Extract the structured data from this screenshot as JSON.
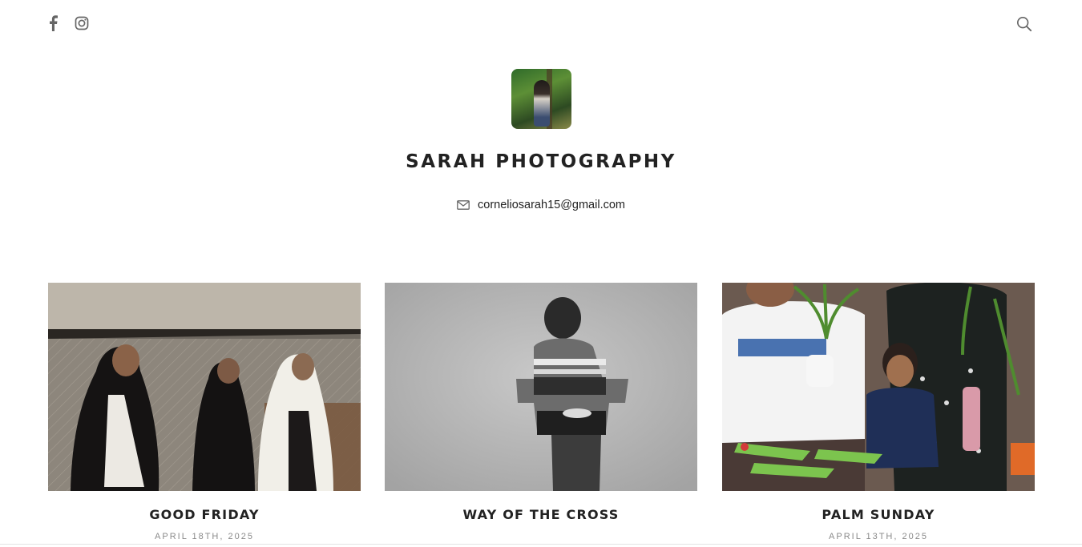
{
  "header": {
    "social": [
      {
        "name": "facebook",
        "icon": "facebook-icon"
      },
      {
        "name": "instagram",
        "icon": "instagram-icon"
      }
    ],
    "search_icon": "search-icon"
  },
  "profile": {
    "title": "SARAH PHOTOGRAPHY",
    "email": "corneliosarah15@gmail.com",
    "email_icon": "envelope-icon"
  },
  "posts": [
    {
      "title": "GOOD FRIDAY",
      "date": "APRIL 18TH, 2025"
    },
    {
      "title": "WAY OF THE CROSS",
      "date": ""
    },
    {
      "title": "PALM SUNDAY",
      "date": "APRIL 13TH, 2025"
    }
  ],
  "colors": {
    "text": "#222222",
    "muted": "#8a8a8a",
    "icon": "#666666"
  }
}
